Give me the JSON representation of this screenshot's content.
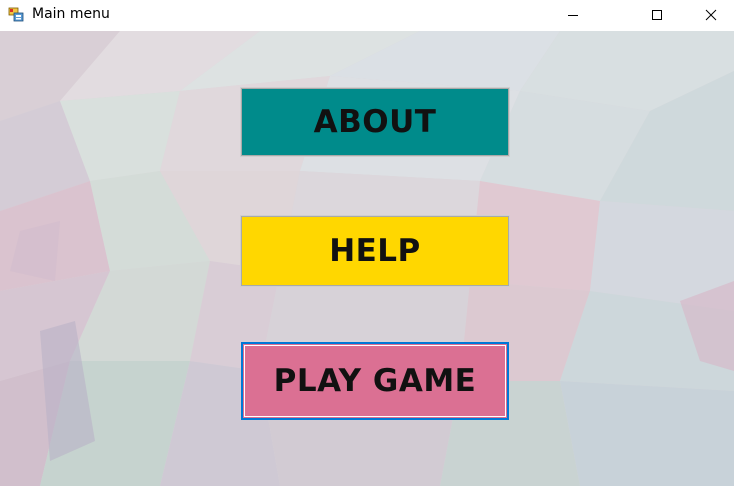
{
  "window": {
    "title": "Main menu",
    "app_icon": "winforms-app-icon",
    "controls": {
      "minimize_icon": "minimize-icon",
      "maximize_icon": "maximize-icon",
      "close_icon": "close-icon"
    }
  },
  "menu": {
    "about_label": "ABOUT",
    "help_label": "HELP",
    "play_label": "PLAY GAME",
    "focused": "PLAY GAME"
  },
  "colors": {
    "about_bg": "#008b8b",
    "help_bg": "#ffd700",
    "play_bg": "#db7093",
    "focus_border": "#0078d7",
    "background": "pastel low-poly mosaic"
  }
}
